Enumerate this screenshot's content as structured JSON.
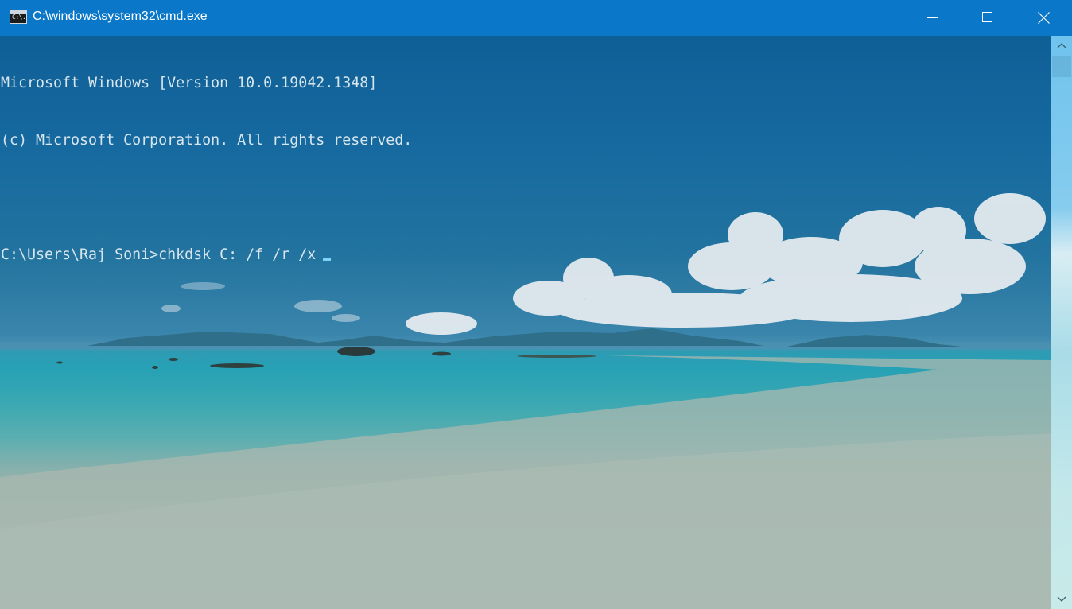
{
  "window": {
    "title": "C:\\windows\\system32\\cmd.exe",
    "icon_label": "C:\\."
  },
  "console": {
    "lines": [
      "Microsoft Windows [Version 10.0.19042.1348]",
      "(c) Microsoft Corporation. All rights reserved.",
      "",
      "C:\\Users\\Raj Soni>chkdsk C: /f /r /x"
    ]
  },
  "icons": {
    "app": "cmd-icon",
    "minimize": "minimize-icon",
    "maximize": "maximize-icon",
    "close": "close-icon",
    "scroll_up": "chevron-up-icon",
    "scroll_down": "chevron-down-icon"
  },
  "colors": {
    "titlebar": "#0b77c8",
    "text": "#d8e6ee",
    "cursor": "#7fd3f6"
  }
}
